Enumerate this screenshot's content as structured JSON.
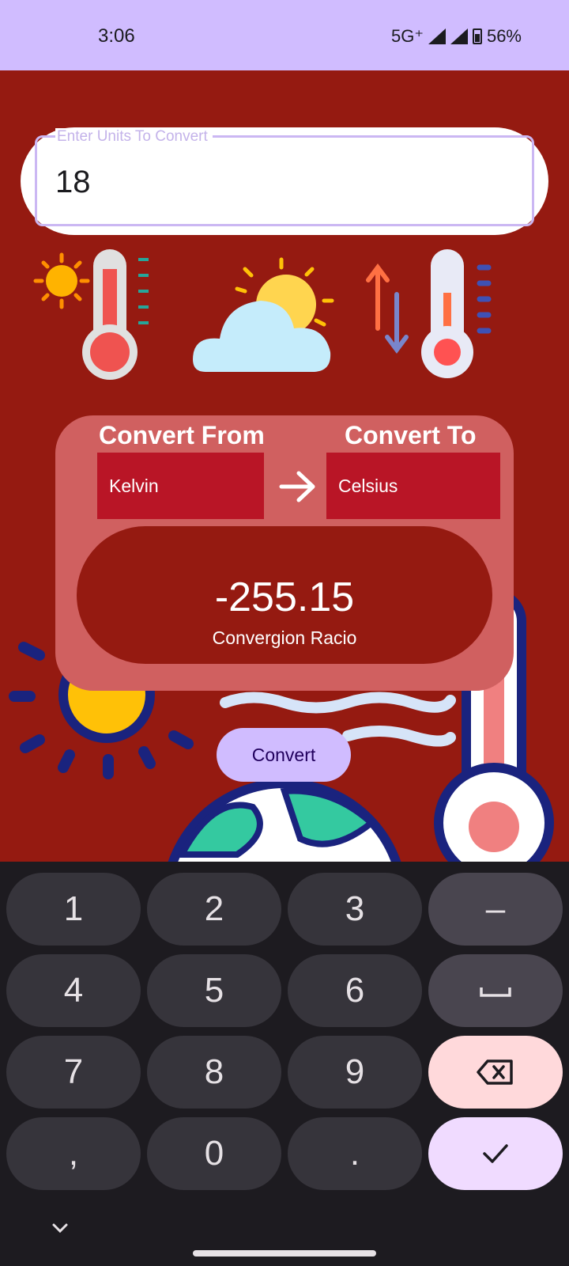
{
  "status_bar": {
    "time": "3:06",
    "network": "5G⁺",
    "battery": "56%"
  },
  "input": {
    "label": "Enter Units To Convert",
    "value": "18"
  },
  "converter": {
    "from_label": "Convert From",
    "to_label": "Convert To",
    "from_unit": "Kelvin",
    "to_unit": "Celsius",
    "result": "-255.15",
    "result_caption": "Convergion Racio"
  },
  "convert_button": "Convert",
  "keyboard": {
    "keys": [
      "1",
      "2",
      "3",
      "–",
      "4",
      "5",
      "6",
      "␣",
      "7",
      "8",
      "9",
      "⌫",
      "ʼ",
      "0",
      ".",
      "✓"
    ],
    "labels": {
      "k1": "1",
      "k2": "2",
      "k3": "3",
      "minus": "–",
      "k4": "4",
      "k5": "5",
      "k6": "6",
      "k7": "7",
      "k8": "8",
      "k9": "9",
      "comma": ",",
      "k0": "0",
      "dot": "."
    }
  },
  "icons": [
    "sun-icon",
    "thermometer-icon",
    "cloud-sun-icon",
    "temperature-exchange-icon",
    "arrow-right-icon",
    "backspace-icon",
    "check-icon",
    "space-icon",
    "chevron-down-icon"
  ],
  "colors": {
    "background": "#951a11",
    "card": "#d06060",
    "select": "#b91526",
    "accent": "#d0bcff"
  }
}
